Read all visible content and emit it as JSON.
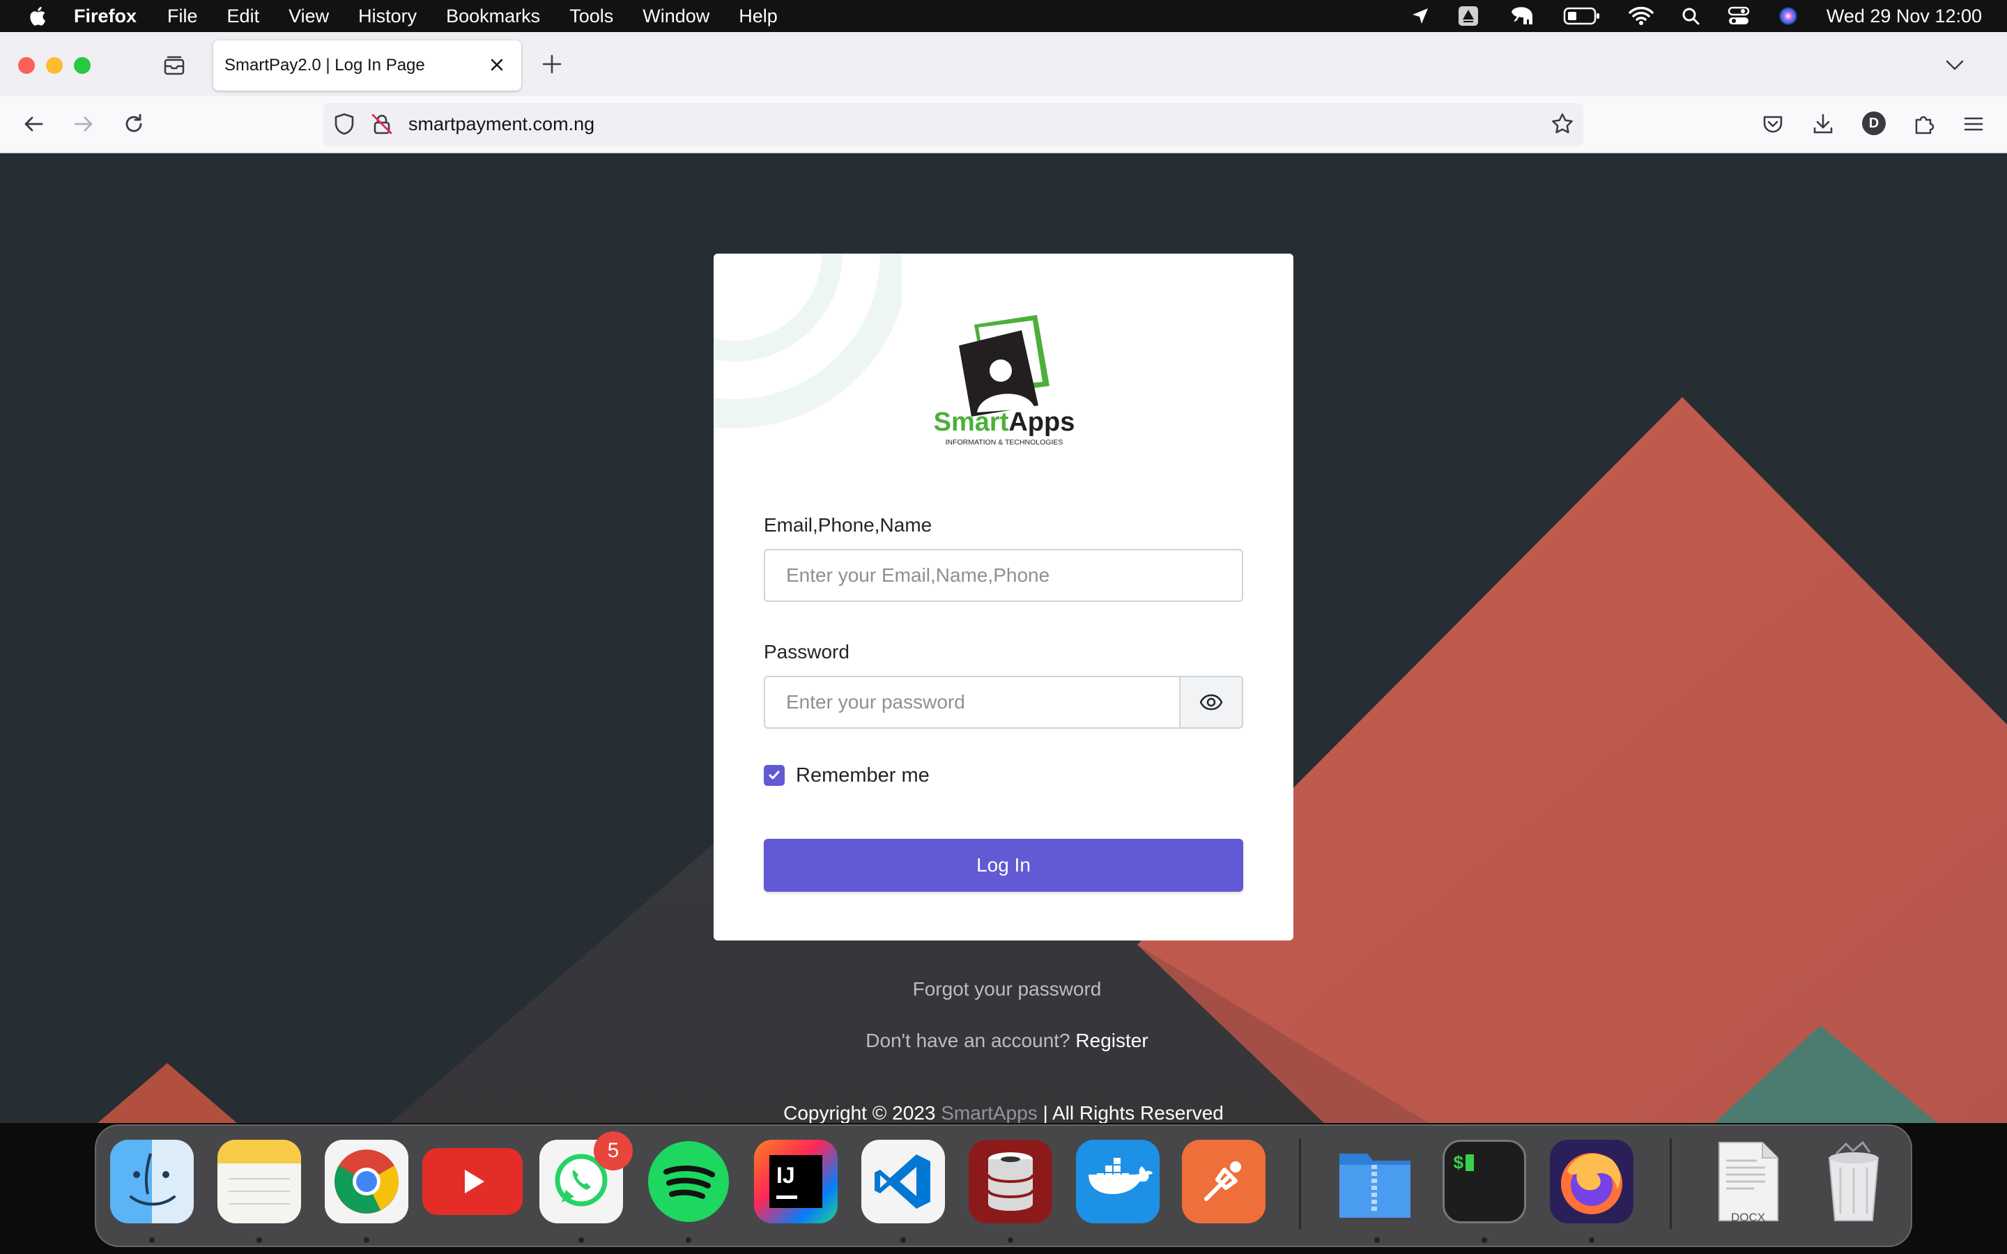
{
  "menubar": {
    "app_name": "Firefox",
    "items": [
      "File",
      "Edit",
      "View",
      "History",
      "Bookmarks",
      "Tools",
      "Window",
      "Help"
    ],
    "clock": "Wed 29 Nov  12:00"
  },
  "browser": {
    "tab_title": "SmartPay2.0 | Log In Page",
    "url": "smartpayment.com.ng",
    "profile_initial": "D"
  },
  "login": {
    "logo_text": "SmartApps",
    "logo_subtext": "INFORMATION & TECHNOLOGIES",
    "email_label": "Email,Phone,Name",
    "email_placeholder": "Enter your Email,Name,Phone",
    "password_label": "Password",
    "password_placeholder": "Enter your password",
    "remember_label": "Remember me",
    "remember_checked": true,
    "login_button": "Log In",
    "forgot_link": "Forgot your password",
    "no_account_text": "Don't have an account?",
    "register_link": "Register",
    "copyright_prefix": "Copyright © 2023",
    "copyright_brand": "SmartApps",
    "copyright_suffix": "| All Rights Reserved"
  },
  "dock": {
    "apps": [
      "finder",
      "notes",
      "chrome",
      "youtube",
      "whatsapp",
      "spotify",
      "intellij",
      "vscode",
      "database",
      "docker",
      "postman",
      "archive-utility",
      "terminal",
      "firefox",
      "docx-document",
      "trash"
    ],
    "whatsapp_badge": "5",
    "docx_label": "DOCX"
  },
  "colors": {
    "primary": "#6259d4",
    "page_background": "#262d33",
    "coral": "#c4594c",
    "logo_green": "#4caf3a"
  }
}
